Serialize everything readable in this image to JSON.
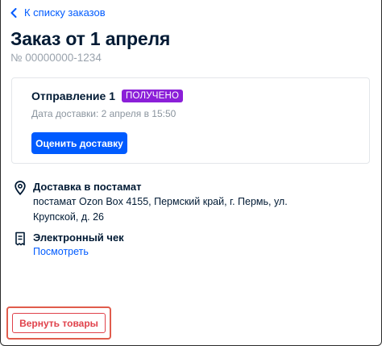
{
  "nav": {
    "back_label": "К списку заказов"
  },
  "order": {
    "title": "Заказ от 1 апреля",
    "number": "№ 00000000-1234"
  },
  "shipment": {
    "label": "Отправление 1",
    "status": "ПОЛУЧЕНО",
    "delivery_date": "Дата доставки: 2 апреля в 15:50",
    "rate_button": "Оценить доставку"
  },
  "delivery": {
    "title": "Доставка в постамат",
    "address_line1": "постамат Ozon Box 4155, Пермский край, г. Пермь, ул.",
    "address_line2": "Крупской, д. 26"
  },
  "receipt": {
    "title": "Электронный чек",
    "link": "Посмотреть"
  },
  "actions": {
    "return_button": "Вернуть товары"
  },
  "colors": {
    "accent": "#005bff",
    "status_badge": "#8b1fd8",
    "danger": "#e0424b",
    "text": "#001a34",
    "muted": "#9aa3ad"
  },
  "icons": [
    "chevron-left-icon",
    "location-pin-icon",
    "receipt-icon"
  ]
}
